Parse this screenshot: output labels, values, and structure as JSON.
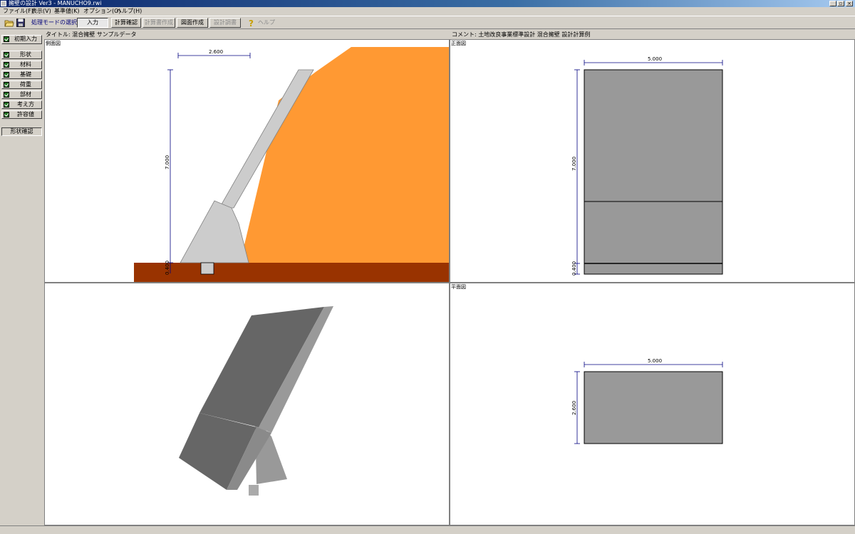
{
  "window": {
    "title": "擁壁の設計 Ver3 - MANUCHO9.rwi"
  },
  "menu": [
    "ファイル(F)",
    "表示(V)",
    "基準値(K)",
    "オプション(O)",
    "ヘルプ(H)"
  ],
  "toolbar": {
    "mode_label": "処理モードの選択",
    "buttons": [
      "入力",
      "計算確認",
      "計算書作成",
      "図面作成",
      "設計調書"
    ],
    "help_label": "ヘルプ"
  },
  "sidebar": {
    "top_button": "初期入力",
    "items": [
      "形状",
      "材料",
      "基礎",
      "荷重",
      "部材",
      "考え方",
      "許容値"
    ],
    "check_button": "形状確認"
  },
  "info": {
    "title": "タイトル: 混合擁壁 サンプルデータ",
    "comment": "コメント: 土地改良事業標準設計 混合擁壁 設計計算例"
  },
  "views": {
    "section": {
      "label": "側面図",
      "dim_width": "2.600",
      "dim_height": "7.000",
      "dim_base": "0.400"
    },
    "front": {
      "label": "正面図",
      "dim_width": "5.000",
      "dim_height": "7.000",
      "dim_base": "0.400"
    },
    "plan": {
      "label": "平面図",
      "dim_width": "5.000",
      "dim_depth": "2.600"
    },
    "iso": {
      "label": ""
    }
  },
  "colors": {
    "soil": "#ff9933",
    "ground": "#993300",
    "concrete": "#cccccc",
    "wall_front": "#999999",
    "dim_line": "#000080"
  }
}
